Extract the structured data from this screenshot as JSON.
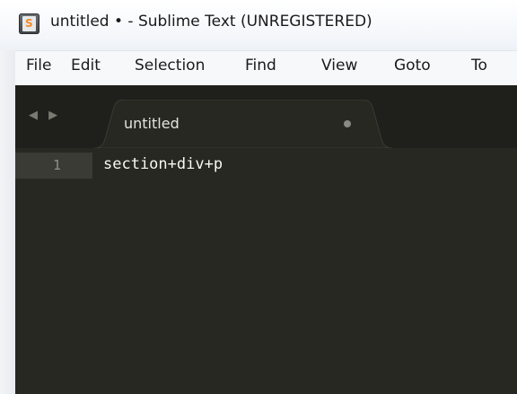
{
  "window": {
    "title": "untitled • - Sublime Text (UNREGISTERED)"
  },
  "menu": {
    "items": [
      "File",
      "Edit",
      "Selection",
      "Find",
      "View",
      "Goto",
      "To"
    ]
  },
  "tabs": [
    {
      "label": "untitled",
      "modified": true
    }
  ],
  "navigation": {
    "arrows": "◀ ▶"
  },
  "editor": {
    "lines": [
      {
        "number": "1",
        "text": "section+div+p"
      }
    ]
  },
  "colors": {
    "editor_background": "#272822",
    "tabbar_background": "#1f201b",
    "text": "#f8f8f2"
  },
  "icons": {
    "app": "sublime-text-icon",
    "tab_modified": "unsaved-dot-icon",
    "nav": "tab-navigation-arrows-icon"
  }
}
